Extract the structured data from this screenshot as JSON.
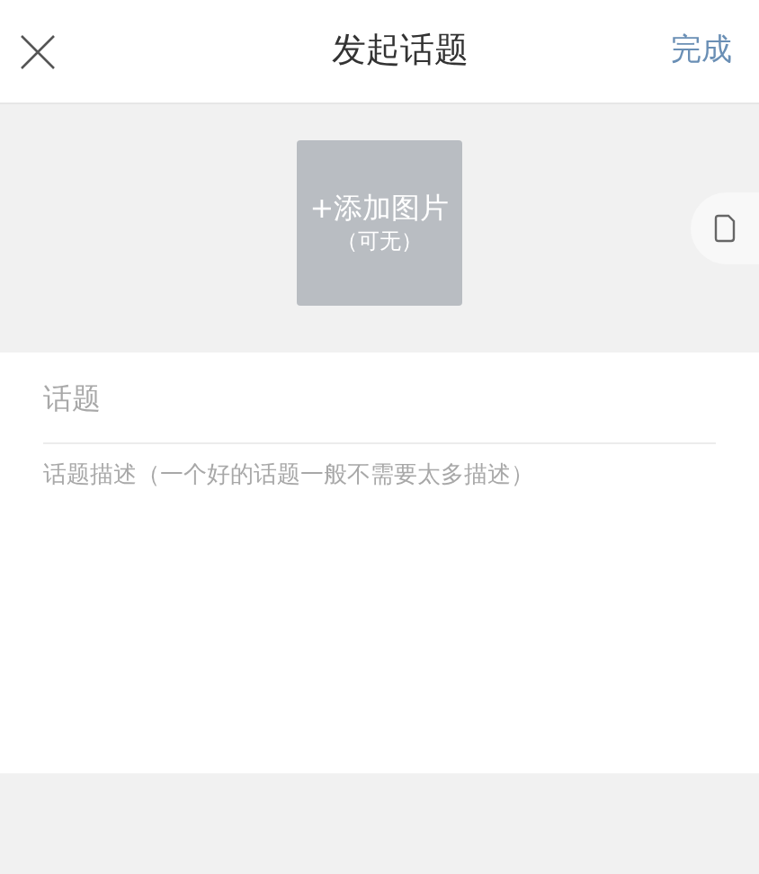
{
  "header": {
    "title": "发起话题",
    "done": "完成"
  },
  "image_picker": {
    "label": "+添加图片",
    "hint": "（可无）"
  },
  "form": {
    "title_placeholder": "话题",
    "description_placeholder": "话题描述（一个好的话题一般不需要太多描述）"
  }
}
